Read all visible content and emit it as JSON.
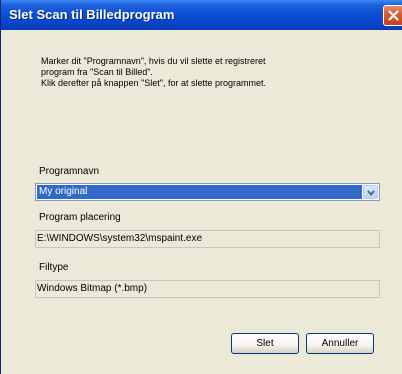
{
  "window": {
    "title": "Slet Scan til Billedprogram",
    "close_icon": "close-icon"
  },
  "instructions": {
    "line1": "Marker dit \"Programnavn\", hvis du vil slette et registreret",
    "line2": "program fra  \"Scan til Billed\".",
    "line3": "Klik derefter på knappen \"Slet\", for at slette programmet."
  },
  "program_name": {
    "label": "Programnavn",
    "selected": "My original",
    "arrow_icon": "chevron-down-icon"
  },
  "program_location": {
    "label": "Program placering",
    "value": "E:\\WINDOWS\\system32\\mspaint.exe"
  },
  "file_type": {
    "label": "Filtype",
    "value": "Windows Bitmap (*.bmp)"
  },
  "buttons": {
    "delete": "Slet",
    "cancel": "Annuller"
  },
  "colors": {
    "title_bar": "#0a4fd6",
    "selection": "#316ac5",
    "dialog_bg": "#ece9d8"
  }
}
